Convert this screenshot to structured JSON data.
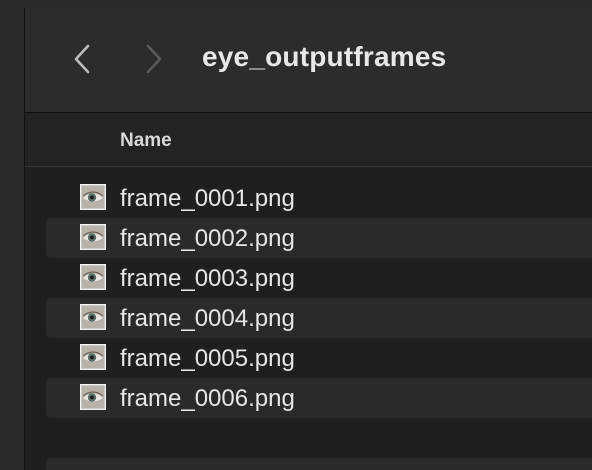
{
  "window": {
    "title": "eye_outputframes"
  },
  "toolbar": {
    "back_icon": "chevron-left-icon",
    "forward_icon": "chevron-right-icon"
  },
  "list_header": {
    "name_label": "Name"
  },
  "files": [
    {
      "name": "frame_0001.png",
      "icon": "png-thumbnail-icon"
    },
    {
      "name": "frame_0002.png",
      "icon": "png-thumbnail-icon"
    },
    {
      "name": "frame_0003.png",
      "icon": "png-thumbnail-icon"
    },
    {
      "name": "frame_0004.png",
      "icon": "png-thumbnail-icon"
    },
    {
      "name": "frame_0005.png",
      "icon": "png-thumbnail-icon"
    },
    {
      "name": "frame_0006.png",
      "icon": "png-thumbnail-icon"
    }
  ],
  "colors": {
    "toolbar_bg": "#2c2c2c",
    "list_bg": "#1f1f1f",
    "alt_row_bg": "#2a2a2a",
    "text": "#e6e6e6"
  }
}
